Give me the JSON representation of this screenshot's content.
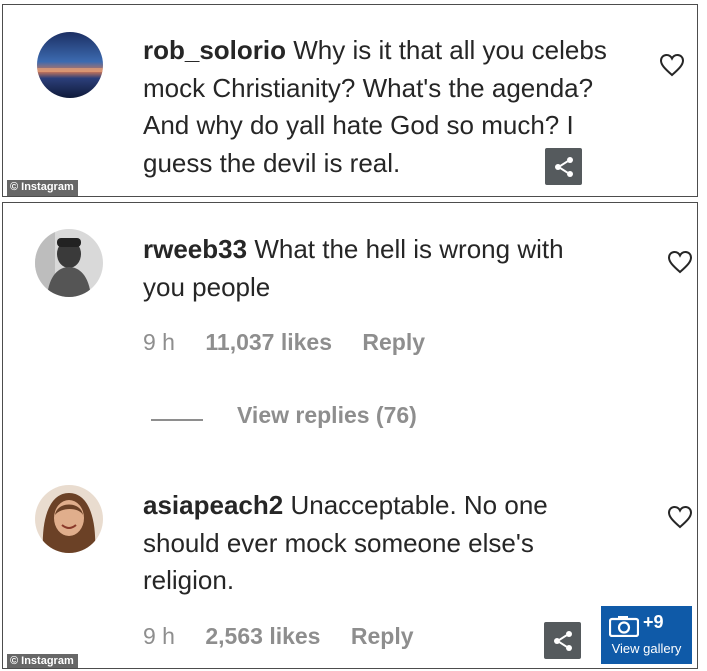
{
  "comments": [
    {
      "username": "rob_solorio",
      "text": "Why is it that all you celebs mock Christianity? What's the agenda? And why do yall hate God so much? I guess the devil is real."
    },
    {
      "username": "rweeb33",
      "text": "What the hell is wrong with you people",
      "time": "9 h",
      "likes": "11,037 likes",
      "reply": "Reply",
      "view_replies": "View replies (76)"
    },
    {
      "username": "asiapeach2",
      "text": "Unacceptable. No one should ever mock someone else's religion.",
      "time": "9 h",
      "likes": "2,563 likes",
      "reply": "Reply"
    }
  ],
  "credit": "© Instagram",
  "gallery": {
    "count": "+9",
    "label": "View gallery"
  },
  "icons": {
    "like": "heart-outline-icon",
    "share": "share-icon",
    "gallery": "camera-icon"
  },
  "colors": {
    "meta_gray": "#8e8e8e",
    "gallery_blue": "#0f5aa8",
    "text": "#262626"
  }
}
